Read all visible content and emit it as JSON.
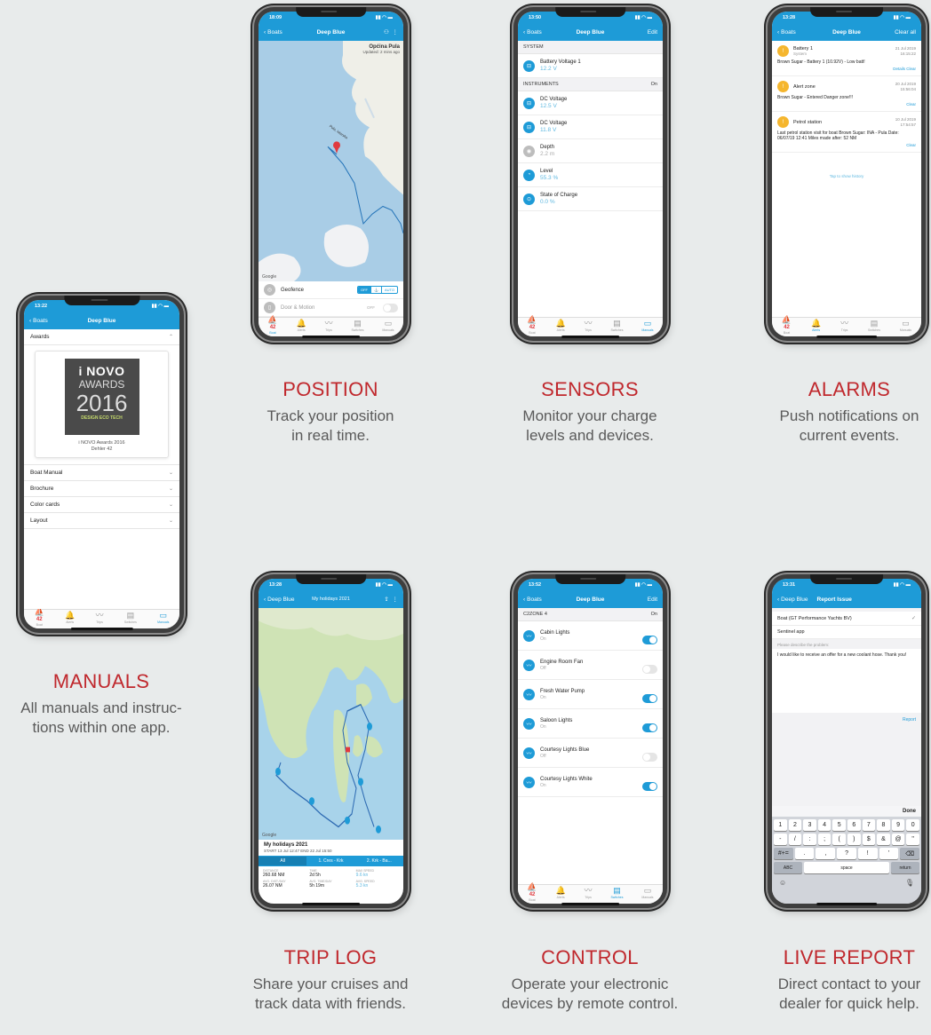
{
  "phones": {
    "position": {
      "time": "18:09",
      "back": "Boats",
      "title": "Deep Blue",
      "place": "Općina Pula",
      "updated": "Updated: 2 mins ago",
      "map_label": "Pula, Istarska",
      "google": "Google",
      "rows": [
        {
          "label": "Geofence",
          "seg": [
            "OFF",
            "⚓",
            "AUTO"
          ]
        },
        {
          "label": "Door & Motion",
          "state": "OFF"
        }
      ]
    },
    "sensors": {
      "time": "13:50",
      "back": "Boats",
      "title": "Deep Blue",
      "action": "Edit",
      "sections": [
        {
          "name": "SYSTEM",
          "right": "",
          "items": [
            {
              "name": "Battery Voltage 1",
              "value": "12.2 V"
            }
          ]
        },
        {
          "name": "INSTRUMENTS",
          "right": "On",
          "items": [
            {
              "name": "DC Voltage",
              "value": "12.5 V"
            },
            {
              "name": "DC Voltage",
              "value": "11.8 V"
            },
            {
              "name": "Depth",
              "value": "2.2 m"
            },
            {
              "name": "Level",
              "value": "55.3 %"
            },
            {
              "name": "State of Charge",
              "value": "0.0 %"
            }
          ]
        }
      ]
    },
    "alarms": {
      "time": "13:28",
      "back": "Boats",
      "title": "Deep Blue",
      "action": "Clear all",
      "items": [
        {
          "title": "Battery 1",
          "sub": "System",
          "date": "21 Jul 2019",
          "clock": "16:15:22",
          "msg": "Brown Sugar - Battery 1 (10.92V) - Low batt!",
          "links": "Details  Clear"
        },
        {
          "title": "Alert zone",
          "sub": "",
          "date": "20 Jul 2019",
          "clock": "15:56:04",
          "msg": "Brown Sugar - Entered Danger zone!!!",
          "links": "Clear"
        },
        {
          "title": "Petrol station",
          "sub": "",
          "date": "10 Jul 2019",
          "clock": "17:54:57",
          "msg": "Last petrol station visit for boat Brown Sugar: INA - Pula Date: 06/07/19 12:41 Miles made after: 52 NM",
          "links": "Clear"
        }
      ],
      "history": "Tap to show history"
    },
    "manuals": {
      "time": "13:22",
      "back": "Boats",
      "title": "Deep Blue",
      "awards": "Awards",
      "logo_top": "i NOVO",
      "logo_mid": "AWARDS",
      "logo_year": "2016",
      "logo_sub": "DESIGN ECO TECH",
      "caption1": "i NOVO Awards 2016",
      "caption2": "Dehler 42",
      "items": [
        "Boat Manual",
        "Brochure",
        "Color cards",
        "Layout"
      ]
    },
    "trip": {
      "time": "13:28",
      "back": "Deep Blue",
      "title": "My holidays 2021",
      "trip_name": "My holidays 2021",
      "trip_dates": "START 13 Jul 12:47  END 22 Jul 15:50",
      "tabs": [
        "All",
        "1. Cres - Krk",
        "2. Krk - Ba..."
      ],
      "stats": [
        {
          "k": "DISTANCE",
          "v": "260.68 NM"
        },
        {
          "k": "TIME",
          "v": "2d 5h"
        },
        {
          "k": "MAX SPEED",
          "v": "9.6 kn"
        },
        {
          "k": "AVG. DIST./DAY",
          "v": "26.07 NM"
        },
        {
          "k": "AVG. TIME/DAY",
          "v": "5h 19m"
        },
        {
          "k": "AVG. SPEED",
          "v": "5.3 kn"
        }
      ],
      "google": "Google"
    },
    "control": {
      "time": "13:52",
      "back": "Boats",
      "title": "Deep Blue",
      "action": "Edit",
      "zone": "C2ZONE 4",
      "zone_state": "On",
      "items": [
        {
          "name": "Cabin Lights",
          "state": "On",
          "on": true
        },
        {
          "name": "Engine Room Fan",
          "state": "Off",
          "on": false
        },
        {
          "name": "Fresh Water Pump",
          "state": "On",
          "on": true
        },
        {
          "name": "Saloon Lights",
          "state": "On",
          "on": true
        },
        {
          "name": "Courtesy Lights Blue",
          "state": "Off",
          "on": false
        },
        {
          "name": "Courtesy Lights White",
          "state": "On",
          "on": true
        }
      ]
    },
    "report": {
      "time": "13:31",
      "back": "Deep Blue",
      "title": "Report Issue",
      "boat": "Boat (GT Performance Yachts BV)",
      "app": "Sentinel app",
      "hint": "Please describe the problem:",
      "text": "I would like to receive an offer for a new coolant hose. Thank you!",
      "send": "Report",
      "done": "Done",
      "row1": [
        "1",
        "2",
        "3",
        "4",
        "5",
        "6",
        "7",
        "8",
        "9",
        "0"
      ],
      "row2": [
        "-",
        "/",
        ":",
        ";",
        "(",
        ")",
        "$",
        "&",
        "@",
        "\""
      ],
      "row3": [
        "#+=",
        ".",
        ",",
        "?",
        "!",
        "'",
        "⌫"
      ],
      "row4": [
        "ABC",
        "space",
        "return"
      ]
    }
  },
  "tabbar": {
    "labels": [
      "Boat",
      "Alerts",
      "Trips",
      "Switches",
      "Manuals"
    ],
    "badge": "42"
  },
  "captions": {
    "position": {
      "title": "POSITION",
      "line1": "Track your position",
      "line2": "in real time."
    },
    "sensors": {
      "title": "SENSORS",
      "line1": "Monitor your charge",
      "line2": "levels and devices."
    },
    "alarms": {
      "title": "ALARMS",
      "line1": "Push notifications on",
      "line2": "current events."
    },
    "manuals": {
      "title": "MANUALS",
      "line1": "All manuals and instruc-",
      "line2": "tions within one app."
    },
    "trip": {
      "title": "TRIP LOG",
      "line1": "Share your cruises and",
      "line2": "track data with friends."
    },
    "control": {
      "title": "CONTROL",
      "line1": "Operate your electronic",
      "line2": "devices by remote control."
    },
    "report": {
      "title": "LIVE REPORT",
      "line1": "Direct contact to your",
      "line2": "dealer for quick help."
    }
  },
  "colors": {
    "accent": "#1e9bd7",
    "caption_red": "#c0282d"
  }
}
